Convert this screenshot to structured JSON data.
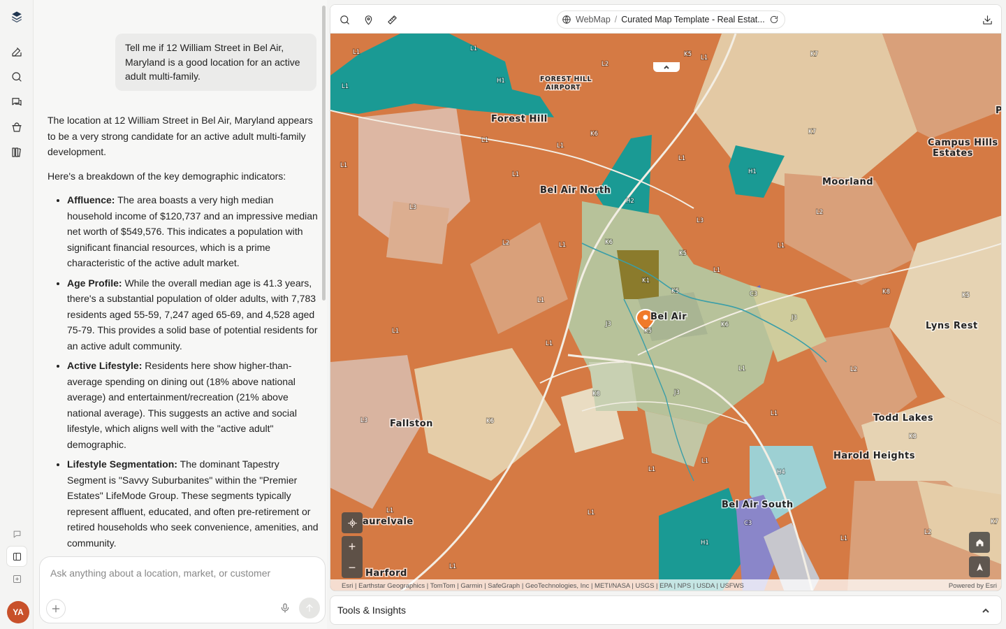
{
  "chat": {
    "user_message": "Tell me if 12 William Street in Bel Air, Maryland is a good location for an active adult multi-family.",
    "intro": "The location at 12 William Street in Bel Air, Maryland appears to be a very strong candidate for an active adult multi-family development.",
    "breakdown_lead": "Here's a breakdown of the key demographic indicators:",
    "bullets": [
      {
        "title": "Affluence:",
        "text": "The area boasts a very high median household income of $120,737 and an impressive median net worth of $549,576. This indicates a population with significant financial resources, which is a prime characteristic of the active adult market."
      },
      {
        "title": "Age Profile:",
        "text": "While the overall median age is 41.3 years, there's a substantial population of older adults, with 7,783 residents aged 55-59, 7,247 aged 65-69, and 4,528 aged 75-79. This provides a solid base of potential residents for an active adult community."
      },
      {
        "title": "Active Lifestyle:",
        "text": "Residents here show higher-than-average spending on dining out (18% above national average) and entertainment/recreation (21% above national average). This suggests an active and social lifestyle, which aligns well with the \"active adult\" demographic."
      },
      {
        "title": "Lifestyle Segmentation:",
        "text": "The dominant Tapestry Segment is \"Savvy Suburbanites\" within the \"Premier Estates\" LifeMode Group. These segments typically represent affluent, educated, and often pre-retirement or retired households who seek convenience, amenities, and community."
      }
    ],
    "input_placeholder": "Ask anything about a location, market, or customer"
  },
  "user": {
    "initials": "YA"
  },
  "map": {
    "breadcrumb_root": "WebMap",
    "breadcrumb_separator": "/",
    "breadcrumb_current": "Curated Map Template - Real Estat...",
    "attribution": "Esri | Earthstar Geographics | TomTom | Garmin | SafeGraph | GeoTechnologies, Inc | METI/NASA | USGS | EPA | NPS | USDA | USFWS",
    "powered_by": "Powered by Esri",
    "zoom_in": "+",
    "zoom_out": "−",
    "places": {
      "forest_hill_airport_1": "FOREST HILL",
      "forest_hill_airport_2": "AIRPORT",
      "forest_hill": "Forest Hill",
      "bel_air_north": "Bel Air North",
      "bel_air": "Bel Air",
      "moorland": "Moorland",
      "campus_hills_1": "Campus Hills",
      "campus_hills_2": "Estates",
      "lyns_rest": "Lyns Rest",
      "todd_lakes": "Todd Lakes",
      "harold_heights": "Harold Heights",
      "fallston": "Fallston",
      "bel_air_south": "Bel Air South",
      "laurelvale": "aurelvale",
      "harford": "Harford",
      "pr": "Pr"
    },
    "segment_codes": [
      "L1",
      "L1",
      "L1",
      "L1",
      "H1",
      "L2",
      "K5",
      "L1",
      "K7",
      "K6",
      "L1",
      "L1",
      "L1",
      "H1",
      "L1",
      "K7",
      "L3",
      "H2",
      "L2",
      "L3",
      "L2",
      "L1",
      "K6",
      "K5",
      "L1",
      "K1",
      "K5",
      "L1",
      "C3",
      "K8",
      "K5",
      "J3",
      "K6",
      "J3",
      "L1",
      "L1",
      "L1",
      "K5",
      "L2",
      "K8",
      "J3",
      "L3",
      "K6",
      "L1",
      "L1",
      "H4",
      "K8",
      "L1",
      "L1",
      "L1",
      "H1",
      "C3",
      "L1",
      "L2",
      "K7",
      "L1",
      "L1"
    ]
  },
  "tools": {
    "label": "Tools & Insights"
  }
}
